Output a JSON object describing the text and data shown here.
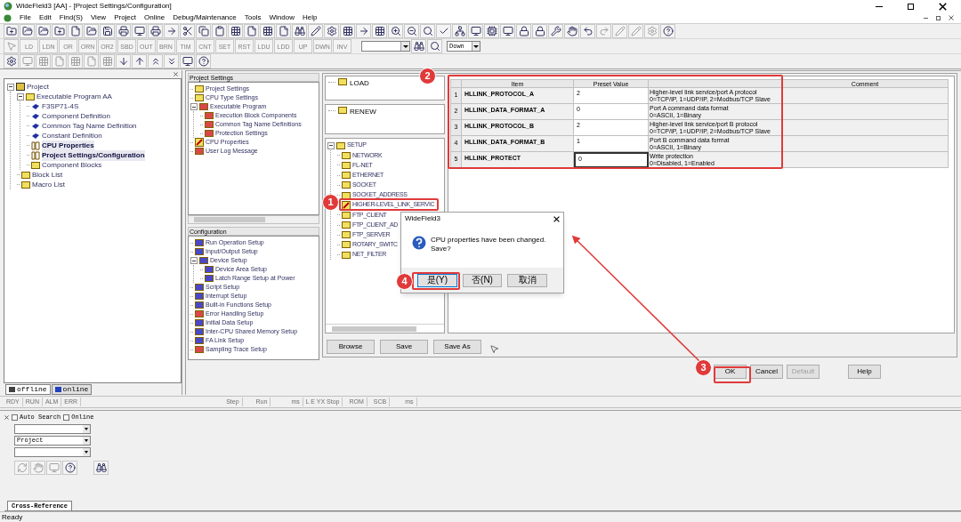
{
  "window": {
    "title": "WideField3 [AA] - [Project Settings/Configuration]"
  },
  "menu": [
    "File",
    "Edit",
    "Find(S)",
    "View",
    "Project",
    "Online",
    "Debug/Maintenance",
    "Tools",
    "Window",
    "Help"
  ],
  "instruction_buttons": [
    "LD",
    "LDN",
    "OR",
    "ORN",
    "OR2",
    "SBD",
    "OUT",
    "BRN",
    "TIM",
    "CNT",
    "SET",
    "RST",
    "LDU",
    "LDD",
    "UP",
    "DWN",
    "INV"
  ],
  "search_direction": "Down",
  "project_tree": [
    {
      "label": "Project",
      "kind": "root",
      "expanded": true,
      "children": [
        {
          "label": "Executable Program AA",
          "kind": "folder",
          "expanded": true,
          "children": [
            {
              "label": "F3SP71-4S",
              "kind": "component",
              "open": false
            },
            {
              "label": "Component Definition",
              "kind": "component",
              "open": false
            },
            {
              "label": "Common Tag Name Definition",
              "kind": "component",
              "open": false
            },
            {
              "label": "Constant Definition",
              "kind": "component",
              "open": false
            },
            {
              "label": "CPU Properties",
              "kind": "document",
              "open": true
            },
            {
              "label": "Project Settings/Configuration",
              "kind": "document",
              "open": true
            },
            {
              "label": "Component Blocks",
              "kind": "folder",
              "open": false
            }
          ]
        },
        {
          "label": "Block List",
          "kind": "folder"
        },
        {
          "label": "Macro List",
          "kind": "folder"
        }
      ]
    }
  ],
  "left_tabs": [
    {
      "label": "offline",
      "selected": true
    },
    {
      "label": "online",
      "selected": false
    }
  ],
  "project_settings": {
    "title": "Project Settings",
    "items": [
      {
        "label": "Project Settings",
        "color": "#f0e060"
      },
      {
        "label": "CPU Type Settings",
        "color": "#f0e060"
      },
      {
        "label": "Executable Program",
        "color": "#d84848",
        "expanded": true,
        "children": [
          {
            "label": "Execution Block Components",
            "color": "#d84848"
          },
          {
            "label": "Common Tag Name Definitions",
            "color": "#d84848"
          },
          {
            "label": "Protection Settings",
            "color": "#d84848"
          }
        ]
      },
      {
        "label": "CPU Properties",
        "kind": "edited"
      },
      {
        "label": "User Log Message",
        "color": "#d84848"
      }
    ]
  },
  "configuration": {
    "title": "Configuration",
    "items": [
      {
        "label": "Run Operation Setup",
        "color": "#4848c8"
      },
      {
        "label": "Input/Output Setup",
        "color": "#4848c8"
      },
      {
        "label": "Device Setup",
        "color": "#4848c8",
        "expanded": true,
        "children": [
          {
            "label": "Device Area Setup",
            "color": "#4848c8"
          },
          {
            "label": "Latch Range Setup at Power",
            "color": "#4848c8"
          }
        ]
      },
      {
        "label": "Script Setup",
        "color": "#4848c8"
      },
      {
        "label": "Interrupt Setup",
        "color": "#4848c8"
      },
      {
        "label": "Built-in Functions Setup",
        "color": "#4848c8"
      },
      {
        "label": "Error Handling Setup",
        "color": "#d84848"
      },
      {
        "label": "Initial Data Setup",
        "color": "#4848c8"
      },
      {
        "label": "Inter-CPU Shared Memory Setup",
        "color": "#4848c8"
      },
      {
        "label": "FA Link Setup",
        "color": "#4848c8"
      },
      {
        "label": "Sampling Trace Setup",
        "color": "#d84848"
      }
    ]
  },
  "load": {
    "label": "LOAD"
  },
  "renew": {
    "label": "RENEW"
  },
  "setup_tree": [
    {
      "label": "SETUP",
      "kind": "folder",
      "expanded": true,
      "children": [
        {
          "label": "NETWORK",
          "kind": "folder"
        },
        {
          "label": "FL-NET",
          "kind": "folder"
        },
        {
          "label": "ETHERNET",
          "kind": "folder"
        },
        {
          "label": "SOCKET",
          "kind": "folder"
        },
        {
          "label": "SOCKET_ADDRESS",
          "kind": "folder"
        },
        {
          "label": "HIGHER-LEVEL_LINK_SERVIC",
          "kind": "edited"
        },
        {
          "label": "FTP_CLIENT",
          "kind": "folder"
        },
        {
          "label": "FTP_CLIENT_AD",
          "kind": "folder"
        },
        {
          "label": "FTP_SERVER",
          "kind": "folder"
        },
        {
          "label": "ROTARY_SWITC",
          "kind": "folder"
        },
        {
          "label": "NET_FILTER",
          "kind": "folder"
        }
      ]
    }
  ],
  "table": {
    "columns": [
      "Item",
      "Preset Value",
      "Comment"
    ],
    "rows": [
      {
        "number": "1",
        "item": "HLLINK_PROTOCOL_A",
        "value": "2",
        "comment": [
          "Higher-level link service/port A protocol",
          "0=TCP/IP, 1=UDP/IP, 2=Modbus/TCP Slave"
        ],
        "selected": false
      },
      {
        "number": "2",
        "item": "HLLINK_DATA_FORMAT_A",
        "value": "0",
        "comment": [
          "Port A command data format",
          "0=ASCII, 1=Binary"
        ],
        "selected": false
      },
      {
        "number": "3",
        "item": "HLLINK_PROTOCOL_B",
        "value": "2",
        "comment": [
          "Higher-level link service/port B protocol",
          "0=TCP/IP, 1=UDP/IP, 2=Modbus/TCP Slave"
        ],
        "selected": false
      },
      {
        "number": "4",
        "item": "HLLINK_DATA_FORMAT_B",
        "value": "1",
        "comment": [
          "Port B command data format",
          "0=ASCII, 1=Binary"
        ],
        "selected": false
      },
      {
        "number": "5",
        "item": "HLLINK_PROTECT",
        "value": "0",
        "comment": [
          "Write protection",
          "0=Disabled, 1=Enabled"
        ],
        "selected": true
      }
    ]
  },
  "file_buttons": [
    "Browse",
    "Save",
    "Save As"
  ],
  "dialog_buttons": [
    {
      "label": "OK",
      "disabled": false
    },
    {
      "label": "Cancel",
      "disabled": false
    },
    {
      "label": "Default",
      "disabled": true
    },
    {
      "label": "Help",
      "disabled": false
    }
  ],
  "message_box": {
    "title": "WideField3",
    "lines": [
      "CPU properties have been changed.",
      "Save?"
    ],
    "buttons": [
      {
        "label": "是(Y)",
        "focused": true
      },
      {
        "label": "否(N)",
        "focused": false
      },
      {
        "label": "取消",
        "focused": false
      }
    ]
  },
  "step_markers": [
    "1",
    "2",
    "3",
    "4"
  ],
  "status_indicators": [
    "RDY",
    "RUN",
    "ALM",
    "ERR",
    "Step",
    "Run",
    "ms",
    "L E YX Stop",
    "ROM",
    "SCB",
    "ms"
  ],
  "search_panel": {
    "checkboxes": [
      {
        "label": "Auto Search",
        "checked": false
      },
      {
        "label": "Online",
        "checked": false
      }
    ],
    "scope": "Project",
    "tab": "Cross-Reference"
  },
  "status_bar": "Ready"
}
